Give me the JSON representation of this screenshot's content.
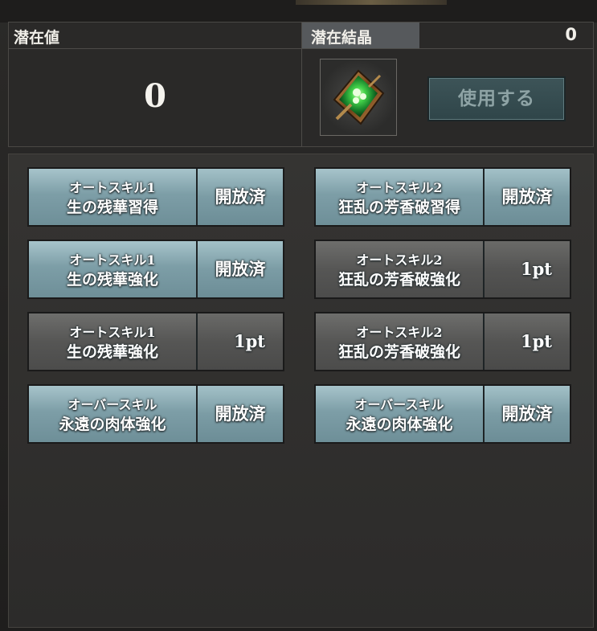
{
  "header": {
    "potential_label": "潜在値",
    "potential_value": "0",
    "crystal_label": "潜在結晶",
    "crystal_count": "0",
    "crystal_icon": "green-crystal-icon",
    "use_button": "使用する"
  },
  "colors": {
    "unlocked_tile": "#7d9ea7",
    "locked_tile": "#565655",
    "use_button": "#3d5458"
  },
  "skills": [
    {
      "line1": "オートスキル1",
      "line2": "生の残華習得",
      "status": "開放済",
      "state": "unlocked"
    },
    {
      "line1": "オートスキル2",
      "line2": "狂乱の芳香破習得",
      "status": "開放済",
      "state": "unlocked"
    },
    {
      "line1": "オートスキル1",
      "line2": "生の残華強化",
      "status": "開放済",
      "state": "unlocked"
    },
    {
      "line1": "オートスキル2",
      "line2": "狂乱の芳香破強化",
      "status": "1pt",
      "state": "locked"
    },
    {
      "line1": "オートスキル1",
      "line2": "生の残華強化",
      "status": "1pt",
      "state": "locked"
    },
    {
      "line1": "オートスキル2",
      "line2": "狂乱の芳香破強化",
      "status": "1pt",
      "state": "locked"
    },
    {
      "line1": "オーバースキル",
      "line2": "永遠の肉体強化",
      "status": "開放済",
      "state": "unlocked"
    },
    {
      "line1": "オーバースキル",
      "line2": "永遠の肉体強化",
      "status": "開放済",
      "state": "unlocked"
    }
  ]
}
